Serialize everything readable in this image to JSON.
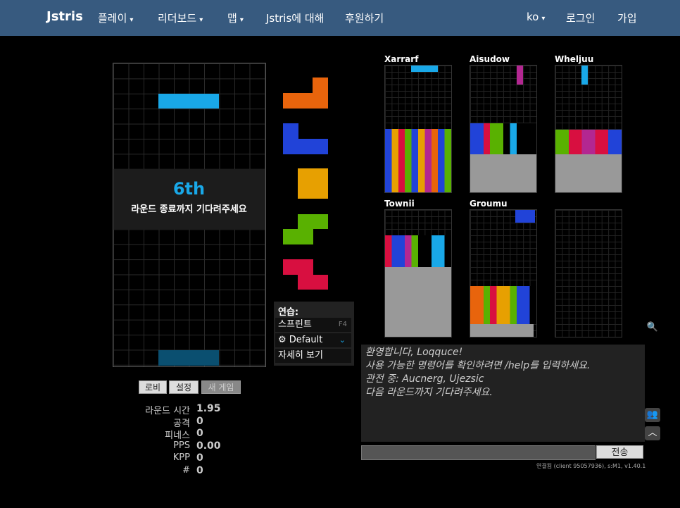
{
  "navbar": {
    "brand": "Jstris",
    "items": [
      {
        "label": "플레이",
        "dropdown": true
      },
      {
        "label": "리더보드",
        "dropdown": true
      },
      {
        "label": "맵",
        "dropdown": true
      },
      {
        "label": "Jstris에 대해",
        "dropdown": false
      },
      {
        "label": "후원하기",
        "dropdown": false
      }
    ],
    "lang": "ko",
    "login": "로그인",
    "signup": "가입"
  },
  "overlay": {
    "place": "6th",
    "message": "라운드 종료까지 기다려주세요"
  },
  "practice": {
    "title": "연습:",
    "sprint": "스프린트",
    "sprint_key": "F4",
    "mode": "Default",
    "more": "자세히 보기"
  },
  "buttons": {
    "lobby": "로비",
    "settings": "설정",
    "new_game": "새 게임"
  },
  "stats": [
    {
      "label": "라운드 시간",
      "value": "1.95"
    },
    {
      "label": "공격",
      "value": "0"
    },
    {
      "label": "피네스",
      "value": "0"
    },
    {
      "label": "PPS",
      "value": "0.00"
    },
    {
      "label": "KPP",
      "value": "0"
    },
    {
      "label": "#",
      "value": "0"
    }
  ],
  "opponents": [
    "Xarrarf",
    "Aisudow",
    "Wheljuu",
    "Townii",
    "Groumu",
    ""
  ],
  "chat": {
    "lines": [
      "환영합니다, Loqquce!",
      "사용 가능한 명령어를 확인하려면 /help를 입력하세요.",
      "관전 중: Aucnerg, Ujezsic",
      "다음 라운드까지 기다려주세요."
    ],
    "send": "전송"
  },
  "footer": "연결됨 (client 95057936), s:M1, v1.40.1",
  "colors": {
    "navbar": "#375a7f",
    "I": "#19a8e8",
    "L": "#e8640c",
    "J": "#2143d8",
    "O": "#e7a001",
    "S": "#59b101",
    "Z": "#d80f40",
    "T": "#b32791",
    "garbage": "#999999",
    "accent": "#19a8e8"
  }
}
